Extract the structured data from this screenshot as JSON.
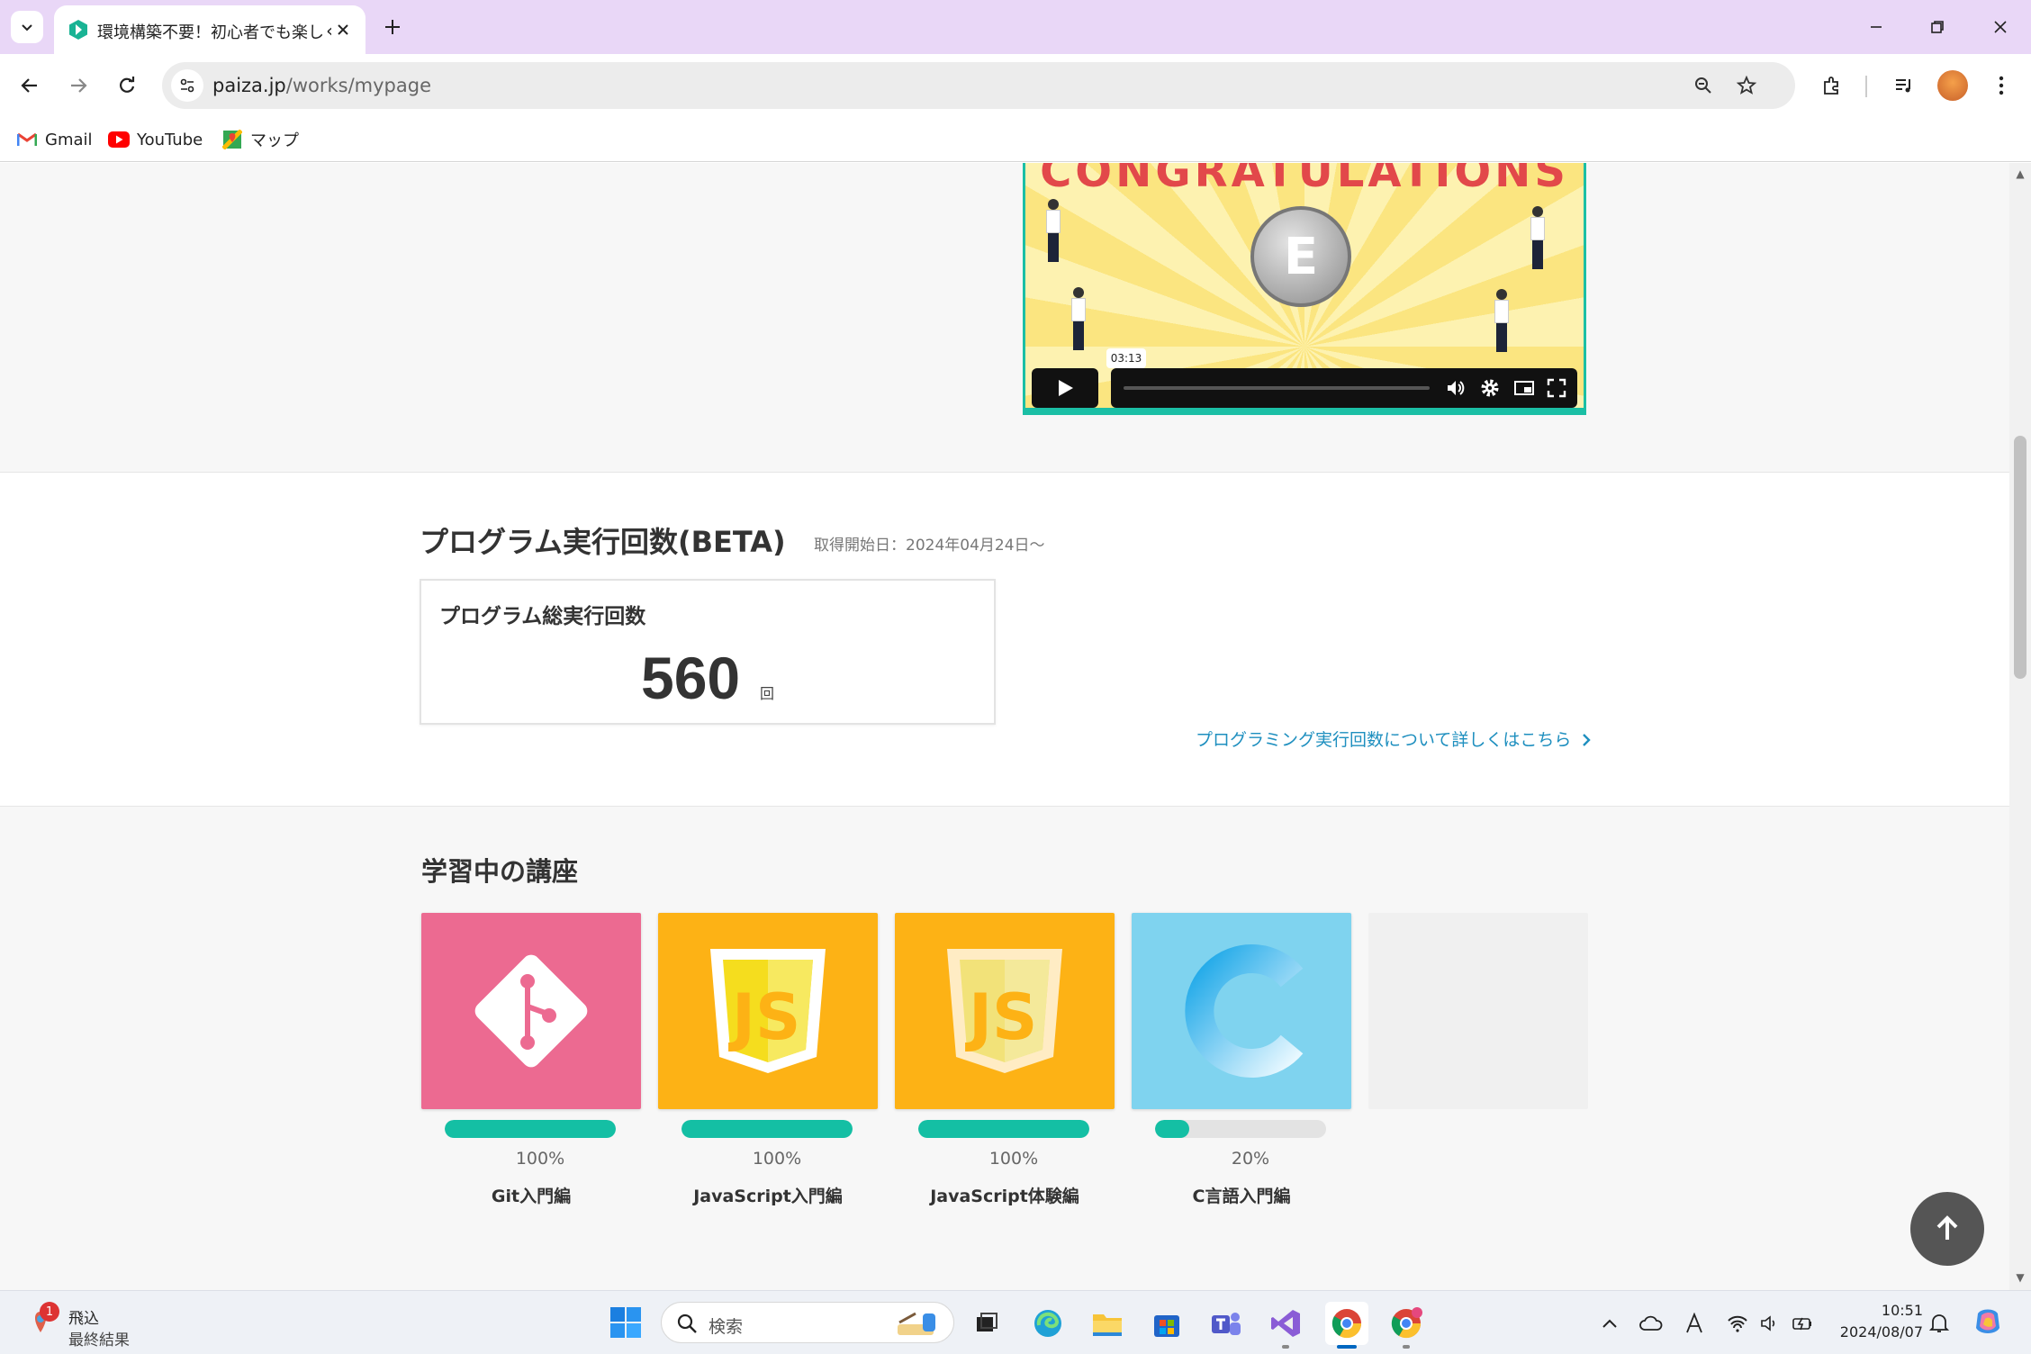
{
  "browser": {
    "tab_title": "環境構築不要！初心者でも楽しく",
    "url_domain": "paiza.jp",
    "url_path": "/works/mypage",
    "bookmarks": [
      {
        "label": "Gmail",
        "icon": "gmail-icon"
      },
      {
        "label": "YouTube",
        "icon": "youtube-icon"
      },
      {
        "label": "マップ",
        "icon": "maps-icon"
      }
    ]
  },
  "video": {
    "banner_text": "CONGRATULATIONS",
    "coin_letter": "E",
    "timestamp": "03:13"
  },
  "run_count": {
    "title": "プログラム実行回数(BETA)",
    "since": "取得開始日：2024年04月24日〜",
    "card_label": "プログラム総実行回数",
    "value": "560",
    "unit": "回",
    "link_text": "プログラミング実行回数について詳しくはこちら"
  },
  "courses": {
    "title": "学習中の講座",
    "items": [
      {
        "name": "Git入門編",
        "percent_label": "100%",
        "progress": 1.0,
        "color": "#ec6a91",
        "icon": "git-icon"
      },
      {
        "name": "JavaScript入門編",
        "percent_label": "100%",
        "progress": 1.0,
        "color": "#fdb215",
        "icon": "javascript-icon"
      },
      {
        "name": "JavaScript体験編",
        "percent_label": "100%",
        "progress": 1.0,
        "color": "#fdb215",
        "icon": "javascript-icon"
      },
      {
        "name": "C言語入門編",
        "percent_label": "20%",
        "progress": 0.2,
        "color": "#7fd3ef",
        "icon": "c-language-icon"
      }
    ]
  },
  "taskbar": {
    "weather_badge": "1",
    "weather_line1": "飛込",
    "weather_line2": "最終結果",
    "search_placeholder": "検索",
    "time": "10:51",
    "date": "2024/08/07"
  },
  "colors": {
    "accent": "#14bfa4",
    "link": "#1e8fbf",
    "tab_bar": "#e9d7f7"
  }
}
